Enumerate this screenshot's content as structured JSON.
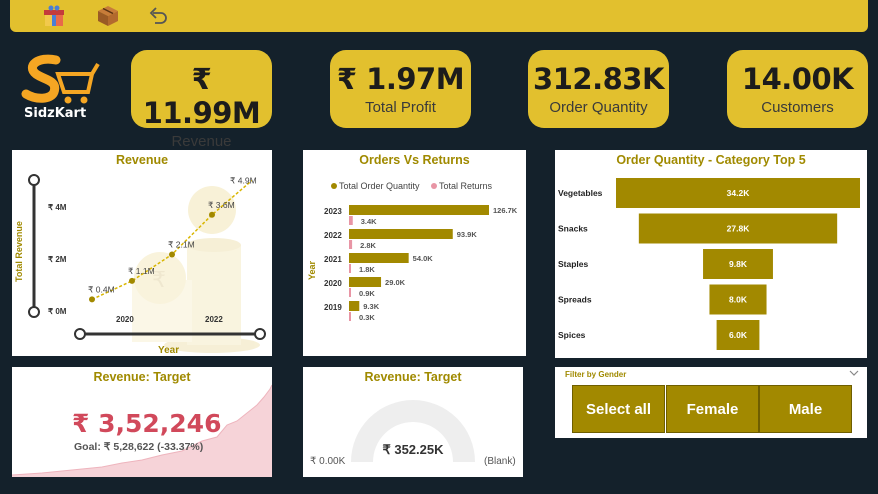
{
  "brand": {
    "name": "SidzKart"
  },
  "topbar": {
    "icons": [
      "gift-icon",
      "package-icon",
      "undo-icon"
    ]
  },
  "kpis": [
    {
      "value": "₹ 11.99M",
      "label": "Revenue"
    },
    {
      "value": "₹ 1.97M",
      "label": "Total Profit"
    },
    {
      "value": "312.83K",
      "label": "Order Quantity"
    },
    {
      "value": "14.00K",
      "label": "Customers"
    }
  ],
  "revenue_chart": {
    "title": "Revenue",
    "ylabel": "Total Revenue",
    "xlabel": "Year",
    "yticks": [
      "₹ 4M",
      "₹ 2M",
      "₹ 0M"
    ],
    "xticks": [
      "2020",
      "2022"
    ],
    "labels": [
      "₹ 0.4M",
      "₹ 1.1M",
      "₹ 2.1M",
      "₹ 3.6M",
      "₹ 4.9M"
    ]
  },
  "orders_chart": {
    "title": "Orders Vs Returns",
    "legend": [
      "Total Order Quantity",
      "Total Returns"
    ],
    "ylabel": "Year",
    "orders_labels": [
      "126.7K",
      "93.9K",
      "54.0K",
      "29.0K",
      "9.3K"
    ],
    "returns_labels": [
      "3.4K",
      "2.8K",
      "1.8K",
      "0.9K",
      "0.3K"
    ],
    "years": [
      "2023",
      "2022",
      "2021",
      "2020",
      "2019"
    ]
  },
  "category_chart": {
    "title": "Order Quantity - Category Top 5",
    "categories": [
      "Vegetables",
      "Snacks",
      "Staples",
      "Spreads",
      "Spices"
    ],
    "value_labels": [
      "34.2K",
      "27.8K",
      "9.8K",
      "8.0K",
      "6.0K"
    ]
  },
  "target_card": {
    "title": "Revenue: Target",
    "value": "₹ 3,52,246",
    "mark": "!",
    "goal": "Goal: ₹ 5,28,622 (-33.37%)"
  },
  "gauge_card": {
    "title": "Revenue: Target",
    "value": "₹ 352.25K",
    "min": "₹ 0.00K",
    "max": "(Blank)"
  },
  "gender_slicer": {
    "title": "Filter by Gender",
    "options": [
      "Select all",
      "Female",
      "Male"
    ]
  },
  "chart_data": [
    {
      "type": "line",
      "title": "Revenue",
      "xlabel": "Year",
      "ylabel": "Total Revenue",
      "x": [
        2019,
        2020,
        2021,
        2022,
        2023
      ],
      "series": [
        {
          "values": [
            0.4,
            1.1,
            2.1,
            3.6,
            4.9
          ]
        }
      ],
      "ylim": [
        0,
        5
      ],
      "grid": false
    },
    {
      "type": "bar",
      "title": "Orders Vs Returns",
      "categories": [
        "2023",
        "2022",
        "2021",
        "2020",
        "2019"
      ],
      "series": [
        {
          "name": "Total Order Quantity",
          "values": [
            126.7,
            93.9,
            54.0,
            29.0,
            9.3
          ],
          "color": "#a28900"
        },
        {
          "name": "Total Returns",
          "values": [
            3.4,
            2.8,
            1.8,
            0.9,
            0.3
          ],
          "color": "#e895a5"
        }
      ],
      "ylabel": "Year",
      "legend": "top"
    },
    {
      "type": "bar",
      "title": "Order Quantity - Category Top 5",
      "categories": [
        "Vegetables",
        "Snacks",
        "Staples",
        "Spreads",
        "Spices"
      ],
      "values": [
        34.2,
        27.8,
        9.8,
        8.0,
        6.0
      ],
      "color": "#a28900"
    }
  ],
  "target_ratio": 0.6663,
  "colors": {
    "accent": "#e2c02e",
    "bar": "#a28900",
    "returns": "#e895a5",
    "bg": "#14212b",
    "kpi_red": "#d1495b"
  }
}
